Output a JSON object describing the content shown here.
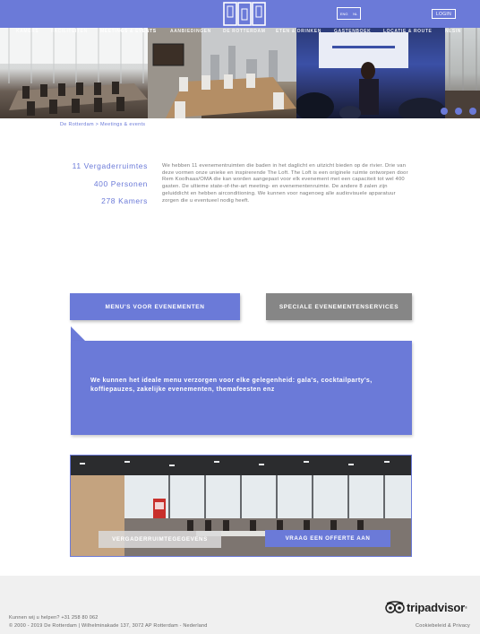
{
  "header": {
    "lang": {
      "left": "ENG",
      "right": "NL"
    },
    "login_label": "LOGIN"
  },
  "nav": {
    "items": [
      "KAMERS",
      "FACILITEITEN",
      "MEETINGS & EVENTS",
      "AANBIEDINGEN",
      "DE ROTTERDAM",
      "ETEN & DRINKEN",
      "GASTENBOEK",
      "LOCATIE & ROUTE",
      "NLSIN"
    ],
    "active_index": 2
  },
  "hero": {
    "slide_count": 3,
    "active_slide": 0
  },
  "breadcrumb": "De Rotterdam > Meetings & events",
  "stats": {
    "rooms": "11 Vergaderruimtes",
    "persons": "400 Personen",
    "hotel_rooms": "278 Kamers"
  },
  "intro_text": "We hebben 11 evenementruimten die baden in het daglicht en uitzicht bieden op de rivier. Drie van deze vormen onze unieke en inspirerende The Loft. The Loft is een originele ruimte ontworpen door Rem Koolhaas/OMA die kan worden aangepast voor elk evenement met een capaciteit tot wel 400 gasten. De ultieme state-of-the-art meeting- en evenementenruimte. De andere 8 zalen zijn geluiddicht en hebben airconditioning. We kunnen voor nagenoeg alle audiovisuele apparatuur zorgen die u eventueel nodig heeft.",
  "buttons": {
    "menus": "MENU'S VOOR EVENEMENTEN",
    "special": "SPECIALE EVENEMENTENSERVICES"
  },
  "menu_panel_text": "We kunnen het ideale menu verzorgen voor elke gelegenheid: gala's, cocktailparty's, koffiepauzes, zakelijke evenementen, themafeesten enz",
  "room_section": {
    "details_label": "VERGADERRUIMTEGEGEVENS",
    "offer_label": "VRAAG EEN OFFERTE AAN"
  },
  "footer": {
    "help": "Kunnen wij u helpen?  +31 258 80 062",
    "copyright": "© 2000 - 2019 De Rotterdam | Wilhelminakade 137, 3072 AP Rotterdam - Nederland",
    "cookie": "Cookiebeleid & Privacy",
    "tripadvisor": "tripadvisor"
  },
  "colors": {
    "accent": "#6b7ad8",
    "secondary_button": "#868686",
    "footer_bg": "#f0f0f0"
  }
}
